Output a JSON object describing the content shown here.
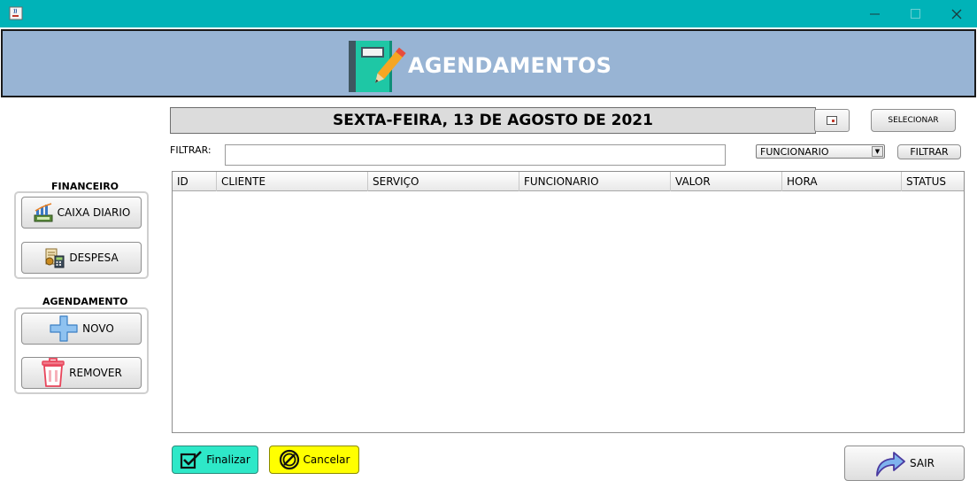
{
  "window": {
    "app_icon": "java-cup-icon",
    "controls": {
      "minimize": "–",
      "maximize": "☐",
      "close": "✕"
    }
  },
  "header": {
    "title": "AGENDAMENTOS",
    "logo_icon": "notebook-pencil-icon",
    "background": "#98b4d4"
  },
  "date_bar": {
    "date_text": "SEXTA-FEIRA, 13 DE AGOSTO DE 2021",
    "calendar_icon": "calendar-icon",
    "select_label": "SELECIONAR"
  },
  "filter": {
    "label": "FILTRAR:",
    "value": "",
    "placeholder": "",
    "combo_selected": "FUNCIONARIO",
    "button_label": "FILTRAR"
  },
  "table": {
    "columns": [
      "ID",
      "CLIENTE",
      "SERVIÇO",
      "FUNCIONARIO",
      "VALOR",
      "HORA",
      "STATUS"
    ],
    "rows": []
  },
  "sidebar": {
    "financeiro": {
      "title": "FINANCEIRO",
      "caixa_label": "CAIXA DIARIO",
      "despesa_label": "DESPESA"
    },
    "agendamento": {
      "title": "AGENDAMENTO",
      "novo_label": "NOVO",
      "remover_label": "REMOVER"
    }
  },
  "actions": {
    "finalizar_label": "Finalizar",
    "cancelar_label": "Cancelar",
    "sair_label": "SAIR"
  },
  "colors": {
    "titlebar": "#00b3b8",
    "finalizar": "#2ee8c8",
    "cancelar": "#ffff00"
  }
}
